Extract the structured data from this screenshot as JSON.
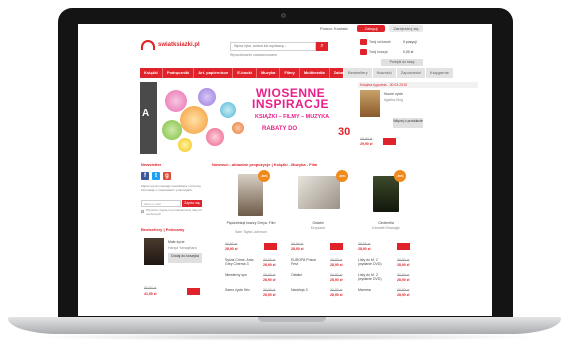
{
  "header": {
    "logo_text": "swiatksiazki.pl",
    "top_links": [
      "Pomoc",
      "Kontakt"
    ],
    "login_label": "Zaloguj",
    "register_label": "Zarejestruj się",
    "search_placeholder": "Wpisz tytuł, autora lub wydawcę...",
    "advanced_search": "Wyszukiwanie zaawansowane",
    "cart_lines": [
      {
        "label": "Twój schowek",
        "value": "0 pozycji"
      },
      {
        "label": "Twój koszyk",
        "value": "0,00 zł"
      }
    ],
    "checkout_label": "Przejdź do kasy",
    "accent_color": "#e0222a"
  },
  "nav": {
    "primary": [
      "Książki",
      "Podręczniki",
      "Art. papiernicze",
      "E-booki",
      "Muzyka",
      "Filmy",
      "Multimedia",
      "Zabawki"
    ],
    "secondary": [
      "Bestsellery",
      "Nowości",
      "Zapowiedzi",
      "Księgarnie"
    ]
  },
  "banner": {
    "title_line1": "WIOSENNE",
    "title_line2": "INSPIRACJE",
    "subtitle": "KSIĄŻKI – FILMY – MUZYKA",
    "promo_label": "RABATY DO",
    "promo_value": "30%"
  },
  "sidebar_promo": {
    "heading": "Książka tygodnia - 30.03.2015",
    "title": "Nocne życie",
    "author": "Agatha King",
    "button_label": "Więcej o produkcie",
    "old_price": "39,90 zł",
    "new_price": "29,90 zł"
  },
  "newsletter": {
    "title": "Newsletter",
    "text": "Zapisz się do naszego newslettera i otrzymuj informacje o nowościach i promocjach.",
    "input_placeholder": "adres e-mail",
    "submit_label": "Zapisz się",
    "consent": "Wyrażam zgodę na przetwarzanie danych osobowych"
  },
  "bestsellers": {
    "title": "Bestsellery | Polecamy",
    "item_title": "Małe życie",
    "item_author": "Hanya Yanagihara",
    "button_label": "Dodaj do koszyka",
    "old_price": "59,90 zł",
    "new_price": "41,90 zł"
  },
  "products_section": {
    "title": "Nowości - aktualne propozycje | Książki - Muzyka - Film",
    "products": [
      {
        "title": "Pięćdziesiąt twarzy Greya. Film",
        "author": "Sam Taylor-Johnson",
        "badge": "-30%",
        "old_price": "39,90 zł",
        "new_price": "28,90 zł"
      },
      {
        "title": "Ostatni",
        "author": "Krzysztof",
        "badge": "-30%",
        "old_price": "39,90 zł",
        "new_price": "28,90 zł"
      },
      {
        "title": "Cinderella",
        "author": "Kenneth Branagh",
        "badge": "-30%",
        "old_price": "39,90 zł",
        "new_price": "28,90 zł"
      }
    ],
    "list_rows": [
      {
        "col1": "Sylvia Crime. Ania Grey Cinema 3",
        "col2": "EUROPA Prison Fest",
        "col3": "Listy do M. 2 (wydanie DVD)"
      },
      {
        "col1": "Niewierny syn",
        "col2": "Ostatni",
        "col3": "Listy do M. 2 (wydanie DVD)"
      },
      {
        "col1": "Samo życie film",
        "col2": "Nadzieja 3",
        "col3": "Mamma"
      }
    ],
    "row_old_price": "39,90 zł",
    "row_new_price": "28,90 zł"
  }
}
